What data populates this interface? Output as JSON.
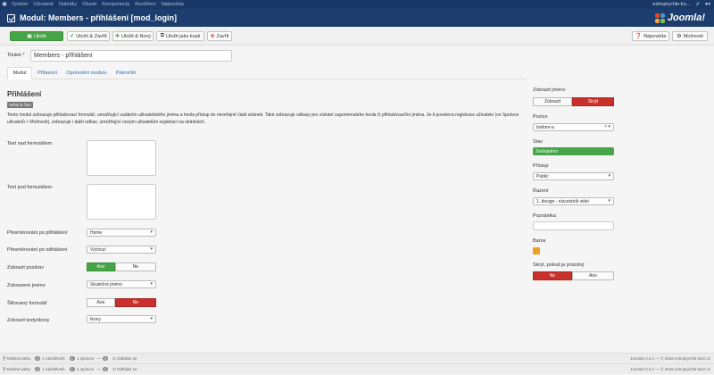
{
  "topbar": {
    "menu": [
      "Systém",
      "Uživatelé",
      "Nabídky",
      "Obsah",
      "Komponenty",
      "Rozšíření",
      "Nápověda"
    ],
    "site": "eshoprychle-ku...",
    "user_icon": "user-icon",
    "gear_icon": "gear-icon"
  },
  "header": {
    "title": "Modul: Members - přihlášení [mod_login]",
    "brand": "Joomla!"
  },
  "toolbar": {
    "save": "Uložit",
    "save_close": "Uložit & Zavřít",
    "save_new": "Uložit & Nový",
    "save_copy": "Uložit jako kopii",
    "close": "Zavřít",
    "help": "Nápověda",
    "options": "Možnosti"
  },
  "form": {
    "title_label": "Titulek *",
    "title_value": "Members - přihlášení"
  },
  "tabs": [
    "Modul",
    "Přiřazení",
    "Oprávnění modulu",
    "Pokročilé"
  ],
  "module": {
    "heading": "Přihlášení",
    "badge": "Veřejná část",
    "description": "Tento modul zobrazuje přihlašovací formulář, umožňující zadáním uživatelského jména a hesla přístup do neveřejné části stránek. Také zobrazuje odkazy pro získání zapomenutého hesla či přihlašovacího jména. Je-li povolena registrace uživatele (ve Správce uživatelů > Možnosti), zobrazuje i další odkaz, umožňující novým uživatelům registraci na stránkách."
  },
  "fields": {
    "pretext_label": "Text nad formulářem",
    "posttext_label": "Text pod formulářem",
    "login_redirect_label": "Přesměrování po přihlášení",
    "login_redirect_value": "Home",
    "logout_redirect_label": "Přesměrování po odhlášení",
    "logout_redirect_value": "Výchozí",
    "greeting_label": "Zobrazit pozdrav",
    "greeting_yes": "Ano",
    "greeting_no": "Ne",
    "name_label": "Zobrazené jméno",
    "name_value": "Skutečné jméno",
    "secure_label": "Šifrovaný formulář",
    "secure_yes": "Ano",
    "secure_no": "Ne",
    "text_icons_label": "Zobrazit texty/ikony",
    "text_icons_value": "Ikony"
  },
  "side": {
    "show_title_label": "Zobrazit jméno",
    "show_title_on": "Zobrazit",
    "show_title_off": "Skrýt",
    "position_label": "Pozice",
    "position_value": "bottom-a",
    "status_label": "Stav",
    "status_value": "Zveřejněno",
    "access_label": "Přístup",
    "access_value": "Public",
    "ordering_label": "Řazení",
    "ordering_value": "1. design - nízcestník videi",
    "note_label": "Poznámka",
    "color_label": "Barva",
    "color_value": "#f0a020",
    "hide_empty_label": "Skrýt, pokud je prázdný",
    "hide_empty_no": "Ne",
    "hide_empty_yes": "Ano"
  },
  "status_rows": [
    {
      "view_site": "Náhled webu",
      "visitors_count": "0",
      "visitors": "1 návštěvník",
      "admins_count": "1",
      "admins": "1 správce",
      "messages_count": "0",
      "logout": "Odhlásit se",
      "version": "Joomla! 3.4.1 — © 2016 eshoprychle-kurz.cz"
    },
    {
      "view_site": "Náhled webu",
      "visitors_count": "0",
      "visitors": "1 návštěvník",
      "admins_count": "1",
      "admins": "1 správce",
      "messages_count": "0",
      "logout": "Odhlásit se",
      "version": "Joomla! 3.4.1 — © 2016 eshoprychle-kurz.cz"
    }
  ],
  "colors": {
    "navy": "#1c3d6e",
    "green": "#46a546",
    "red": "#c9302c",
    "orange": "#f0a020"
  }
}
